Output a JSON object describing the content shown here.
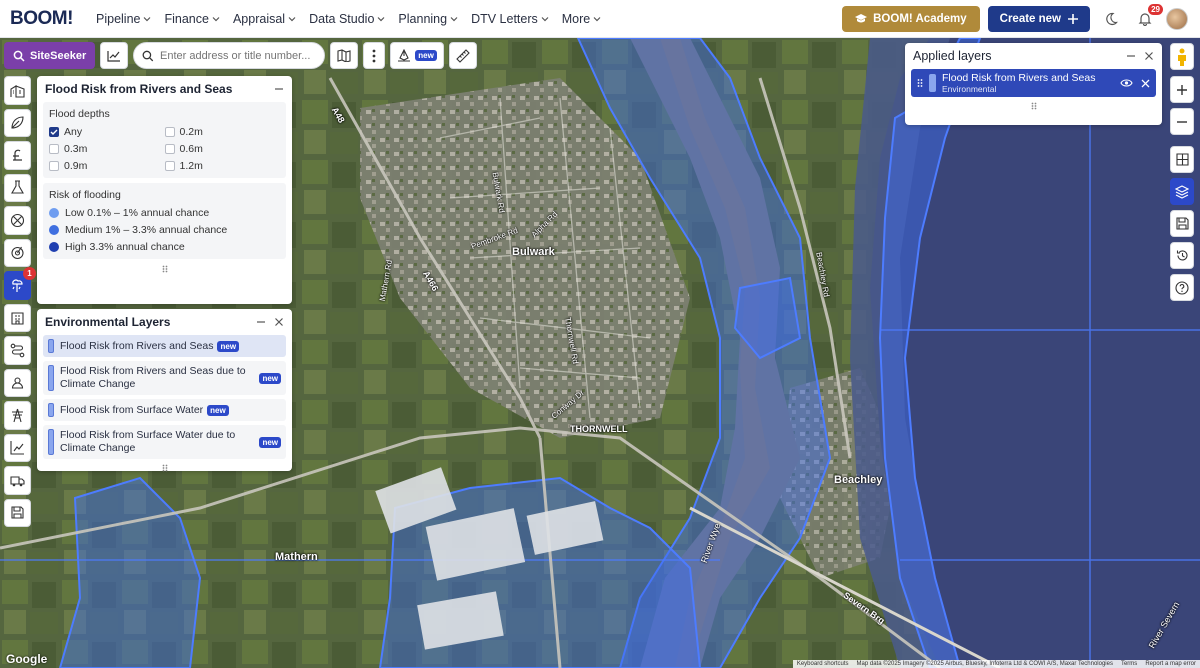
{
  "nav": {
    "logo": "BOOM!",
    "items": [
      "Pipeline",
      "Finance",
      "Appraisal",
      "Data Studio",
      "Planning",
      "DTV Letters",
      "More"
    ],
    "academy_label": "BOOM! Academy",
    "create_label": "Create new",
    "notifications": "29"
  },
  "toolbar": {
    "siteseeker_label": "SiteSeeker",
    "search_placeholder": "Enter address or title number...",
    "draw_badge": "new"
  },
  "leftbar": {
    "badge": "1"
  },
  "flood_panel": {
    "title": "Flood Risk from Rivers and Seas",
    "depths_title": "Flood depths",
    "depths": [
      {
        "label": "Any",
        "checked": true
      },
      {
        "label": "0.2m",
        "checked": false
      },
      {
        "label": "0.3m",
        "checked": false
      },
      {
        "label": "0.6m",
        "checked": false
      },
      {
        "label": "0.9m",
        "checked": false
      },
      {
        "label": "1.2m",
        "checked": false
      }
    ],
    "risk_title": "Risk of flooding",
    "risks": [
      {
        "label": "Low 0.1% – 1% annual chance",
        "color": "#6f9df0"
      },
      {
        "label": "Medium 1% – 3.3% annual chance",
        "color": "#3f6fe0"
      },
      {
        "label": "High 3.3% annual chance",
        "color": "#1f3fb0"
      }
    ]
  },
  "env_panel": {
    "title": "Environmental Layers",
    "layers": [
      {
        "label": "Flood Risk from Rivers and Seas",
        "badge": "new"
      },
      {
        "label": "Flood Risk from Rivers and Seas due to Climate Change",
        "badge": "new"
      },
      {
        "label": "Flood Risk from Surface Water",
        "badge": "new"
      },
      {
        "label": "Flood Risk from Surface Water due to Climate Change",
        "badge": "new"
      }
    ]
  },
  "applied_panel": {
    "title": "Applied layers",
    "layer_name": "Flood Risk from Rivers and Seas",
    "layer_category": "Environmental"
  },
  "map": {
    "labels": [
      "Bulwark",
      "THORNWELL",
      "Beachley",
      "Mathern",
      "A466",
      "A48",
      "Severn Brg",
      "River Severn",
      "River Wye",
      "Pembroke Rd",
      "Alpha Rd",
      "Conway Dr",
      "Thornwell Rd",
      "Beachley Rd",
      "Mathern Rd",
      "Bulwark Rd"
    ],
    "attribution": [
      "Keyboard shortcuts",
      "Map data ©2025 Imagery ©2025 Airbus, Bluesky, Infoterra Ltd & COWI A/S, Maxar Technologies",
      "Terms",
      "Report a map error"
    ],
    "google": "Google",
    "flood_color": "#3d6cf0"
  }
}
